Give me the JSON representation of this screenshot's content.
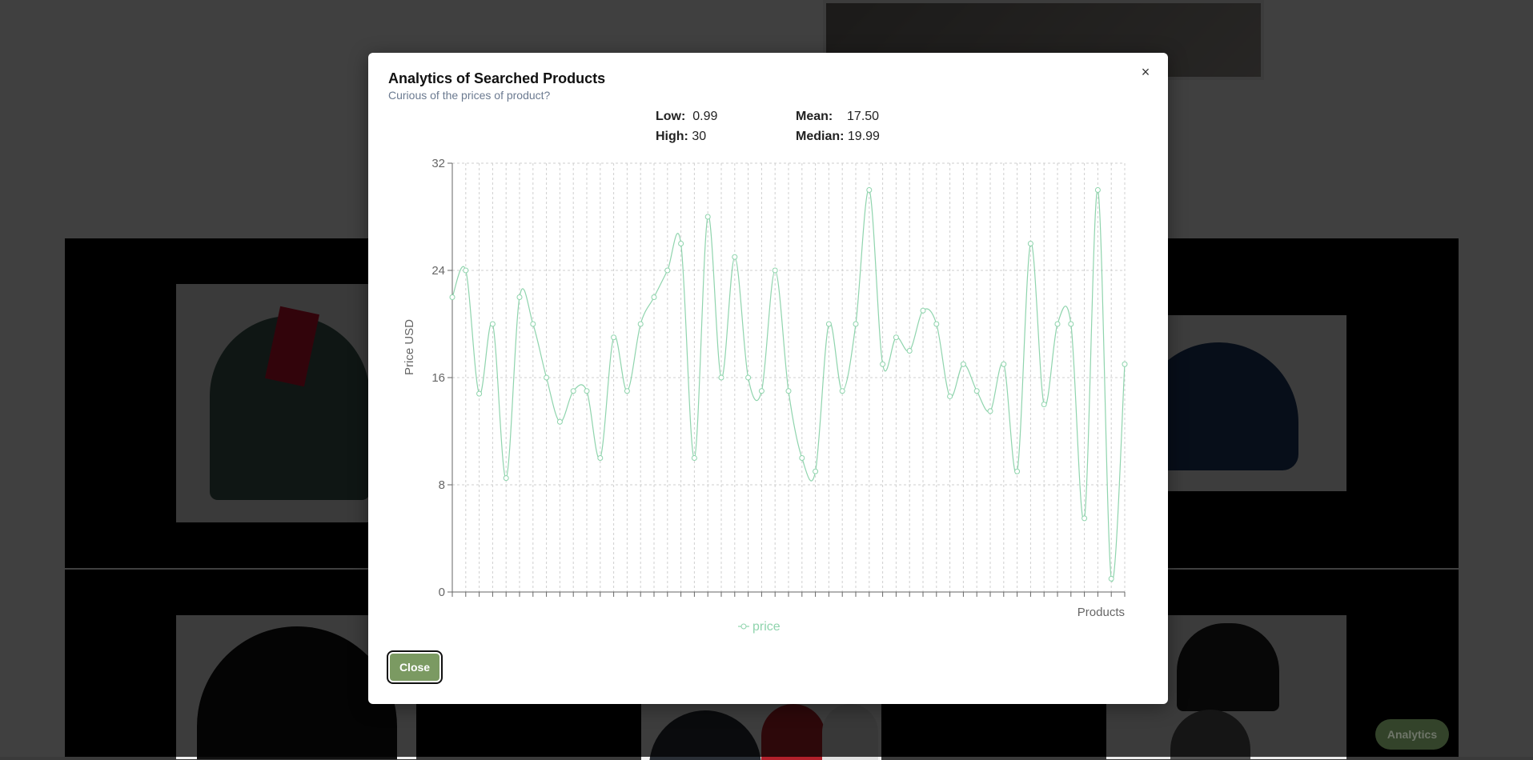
{
  "modal": {
    "title": "Analytics of Searched Products",
    "subtitle": "Curious of the prices of product?",
    "close_x": "×",
    "close_label": "Close"
  },
  "stats": {
    "low_label": "Low:",
    "low_value": "0.99",
    "high_label": "High:",
    "high_value": "30",
    "mean_label": "Mean:",
    "mean_value": "17.50",
    "median_label": "Median:",
    "median_value": "19.99"
  },
  "analytics_button": "Analytics",
  "colors": {
    "line": "#8fd4ad",
    "close_button": "#7b9a62",
    "grid": "#cfcfcf"
  },
  "chart_data": {
    "type": "line",
    "title": "",
    "xlabel": "Products",
    "ylabel": "Price USD",
    "ylim": [
      0,
      32
    ],
    "yticks": [
      0,
      8,
      16,
      24,
      32
    ],
    "grid": true,
    "legend_position": "bottom",
    "series": [
      {
        "name": "price",
        "values": [
          22,
          24,
          14.8,
          20,
          8.5,
          22,
          20,
          16,
          12.7,
          15,
          15,
          10,
          19,
          15,
          20,
          22,
          24,
          26,
          10,
          28,
          16,
          25,
          16,
          15,
          24,
          15,
          10,
          9,
          20,
          15,
          20,
          30,
          17,
          19,
          18,
          21,
          20,
          14.6,
          17,
          15,
          13.5,
          17,
          9,
          26,
          14,
          20,
          20,
          5.5,
          30,
          0.99,
          17
        ]
      }
    ]
  }
}
